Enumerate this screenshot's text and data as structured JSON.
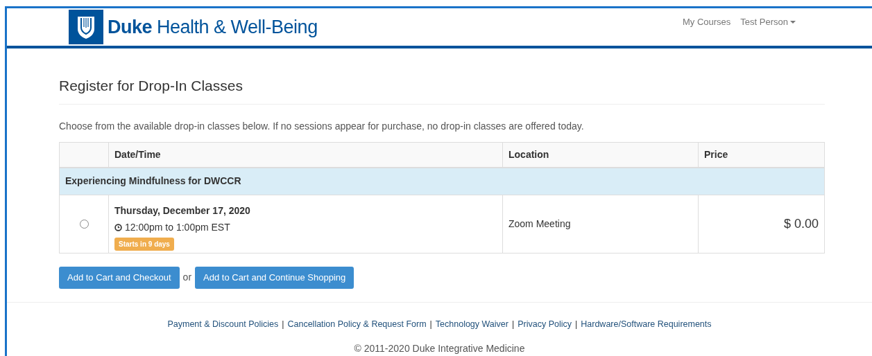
{
  "header": {
    "logo_text": "**Duke** Health & Well-Being",
    "nav": [
      {
        "label": "My Courses",
        "dropdown": false
      },
      {
        "label": "Test Person",
        "dropdown": true
      }
    ]
  },
  "page": {
    "title": "Register for Drop-In Classes",
    "intro": "Choose from the available drop-in classes below. If no sessions appear for purchase, no drop-in classes are offered today."
  },
  "table": {
    "columns": [
      "Date/Time",
      "Location",
      "Price"
    ],
    "groups": [
      {
        "name": "Experiencing Mindfulness for DWCCR",
        "sessions": [
          {
            "selected": false,
            "date": "Thursday, December 17, 2020",
            "time": "12:00pm to 1:00pm EST",
            "badge": "Starts in 9 days",
            "location": "Zoom Meeting",
            "price": "$ 0.00"
          }
        ]
      }
    ]
  },
  "actions": {
    "primary": "Add to Cart and Checkout",
    "separator": "or",
    "secondary": "Add to Cart and Continue Shopping"
  },
  "footer": {
    "separator": "|",
    "links": [
      "Payment & Discount Policies",
      "Cancellation Policy & Request Form",
      "Technology Waiver",
      "Privacy Policy",
      "Hardware/Software Requirements"
    ],
    "copyright": "© 2011-2020 Duke Integrative Medicine"
  }
}
